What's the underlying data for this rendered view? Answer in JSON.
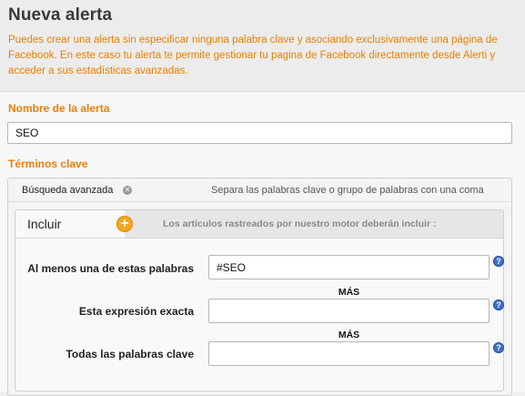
{
  "header": {
    "title": "Nueva alerta",
    "intro": "Puedes crear una alerta sin especificar ninguna palabra clave y asociando exclusivamente una página de Facebook. En este caso tu alerta te permite gestionar tu pagina de Facebook directamente desde Alerti y acceder a sus estadísticas avanzadas."
  },
  "alert_name": {
    "label": "Nombre de la alerta",
    "value": "SEO"
  },
  "keywords": {
    "label": "Términos clave",
    "advanced_search_label": "Búsqueda avanzada",
    "close_icon": "close-icon",
    "hint": "Separa las palabras clave o grupo de palabras con una coma",
    "include": {
      "title": "Incluir",
      "add_icon": "plus-icon",
      "description": "Los artículos rastreados por nuestro motor deberán incluir :",
      "any_words_label": "Al menos una de estas palabras",
      "any_words_value": "#SEO",
      "exact_phrase_label": "Esta expresión exacta",
      "exact_phrase_value": "",
      "all_words_label": "Todas las palabras clave",
      "all_words_value": "",
      "separator": "MÁS",
      "help_glyph": "?"
    }
  },
  "colors": {
    "accent": "#ee7f00",
    "help": "#3f6fc8",
    "add": "#f5a623"
  }
}
